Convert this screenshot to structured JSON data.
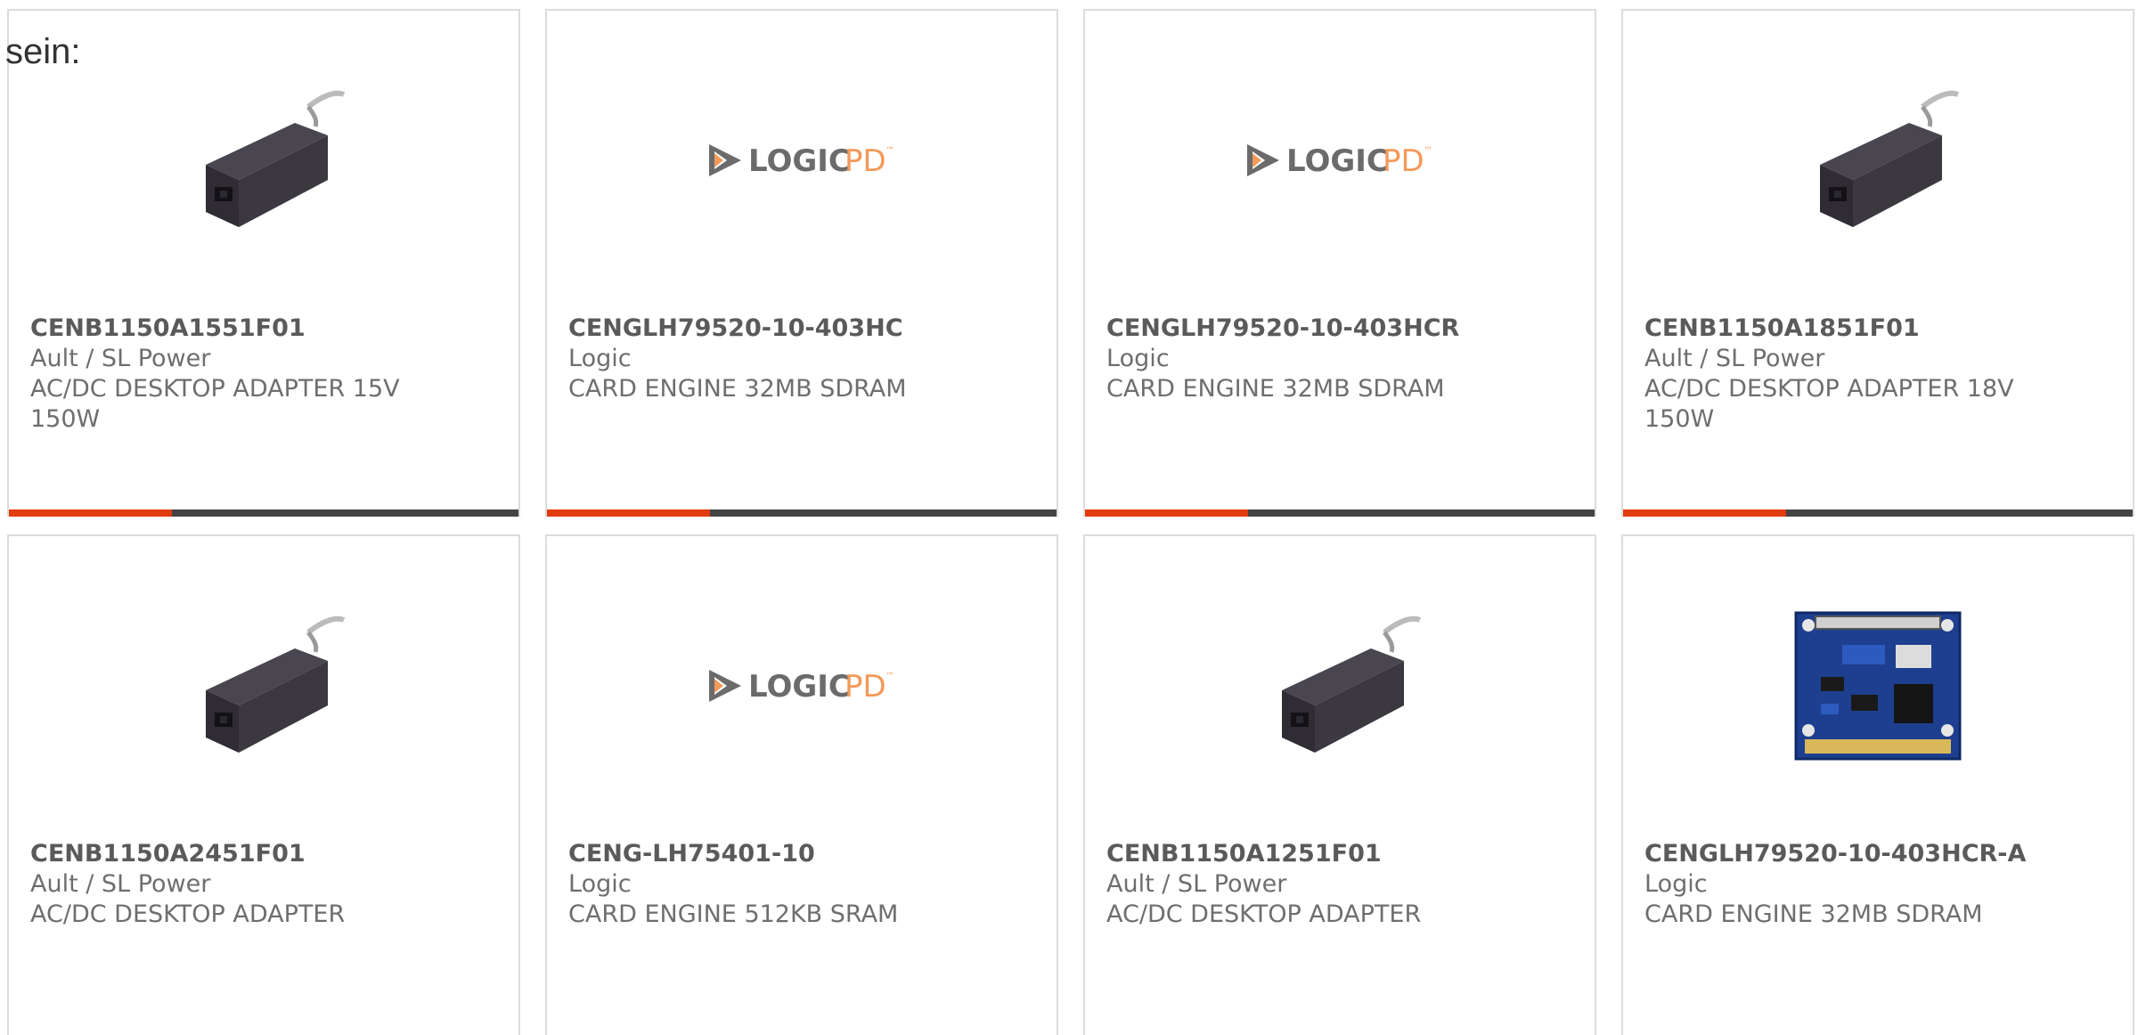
{
  "page": {
    "top_label": "sein:"
  },
  "colors": {
    "accent": "#e03c10",
    "bar_track": "#444444",
    "card_border": "#dcdcdc",
    "text": "#666666",
    "logic_gray": "#6b6b6b",
    "logic_orange": "#f39a5a"
  },
  "logo": {
    "word1": "LOGIC",
    "word2": "PD",
    "mark": "™"
  },
  "products": [
    {
      "part": "CENB1150A1551F01",
      "maker": "Ault / SL Power",
      "desc": "AC/DC DESKTOP ADAPTER 15V 150W",
      "image": "power-adapter-icon"
    },
    {
      "part": "CENGLH79520-10-403HC",
      "maker": "Logic",
      "desc": "CARD ENGINE 32MB SDRAM",
      "image": "logic-pd-logo-icon"
    },
    {
      "part": "CENGLH79520-10-403HCR",
      "maker": "Logic",
      "desc": "CARD ENGINE 32MB SDRAM",
      "image": "logic-pd-logo-icon"
    },
    {
      "part": "CENB1150A1851F01",
      "maker": "Ault / SL Power",
      "desc": "AC/DC DESKTOP ADAPTER 18V 150W",
      "image": "power-adapter-icon"
    },
    {
      "part": "CENB1150A2451F01",
      "maker": "Ault / SL Power",
      "desc": "AC/DC DESKTOP ADAPTER",
      "image": "power-adapter-icon"
    },
    {
      "part": "CENG-LH75401-10",
      "maker": "Logic",
      "desc": "CARD ENGINE 512KB SRAM",
      "image": "logic-pd-logo-icon"
    },
    {
      "part": "CENB1150A1251F01",
      "maker": "Ault / SL Power",
      "desc": "AC/DC DESKTOP ADAPTER",
      "image": "power-adapter-icon"
    },
    {
      "part": "CENGLH79520-10-403HCR-A",
      "maker": "Logic",
      "desc": "CARD ENGINE 32MB SDRAM",
      "image": "circuit-board-icon"
    }
  ],
  "card_progress": [
    0.32,
    0.32,
    0.32,
    0.32
  ]
}
